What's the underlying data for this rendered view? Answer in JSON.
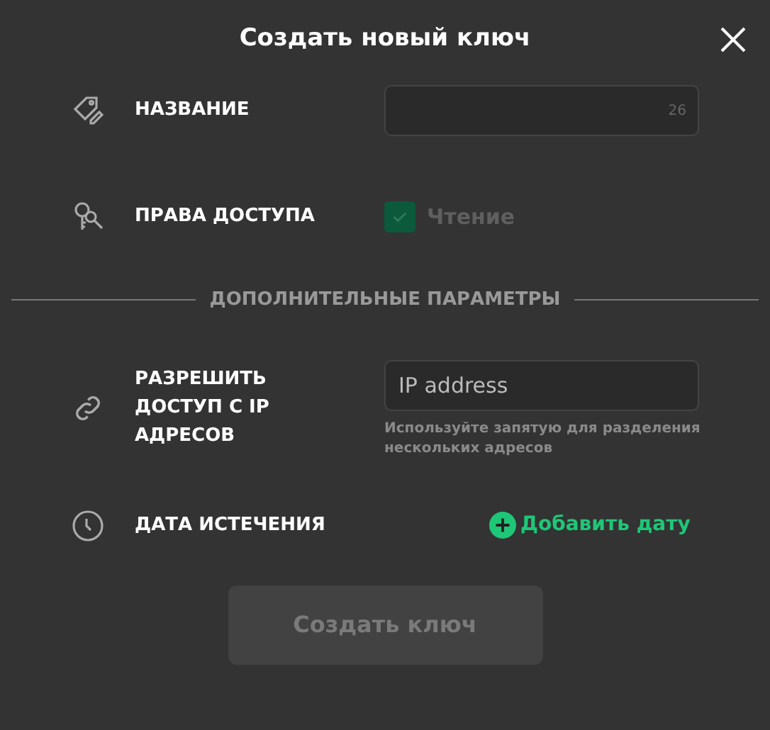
{
  "dialog": {
    "title": "Создать новый ключ"
  },
  "name_row": {
    "label": "НАЗВАНИЕ",
    "counter": "26"
  },
  "access_row": {
    "label": "ПРАВА ДОСТУПА",
    "options": [
      {
        "label": "Чтение",
        "checked": true,
        "disabled": true
      }
    ]
  },
  "section_divider": "ДОПОЛНИТЕЛЬНЫЕ ПАРАМЕТРЫ",
  "ip_row": {
    "label": "РАЗРЕШИТЬ ДОСТУП С IP АДРЕСОВ",
    "placeholder": "IP address",
    "hint": "Используйте запятую для разделения нескольких адресов"
  },
  "expiry_row": {
    "label": "ДАТА ИСТЕЧЕНИЯ",
    "action": "Добавить дату"
  },
  "submit": {
    "label": "Создать ключ",
    "disabled": true
  }
}
